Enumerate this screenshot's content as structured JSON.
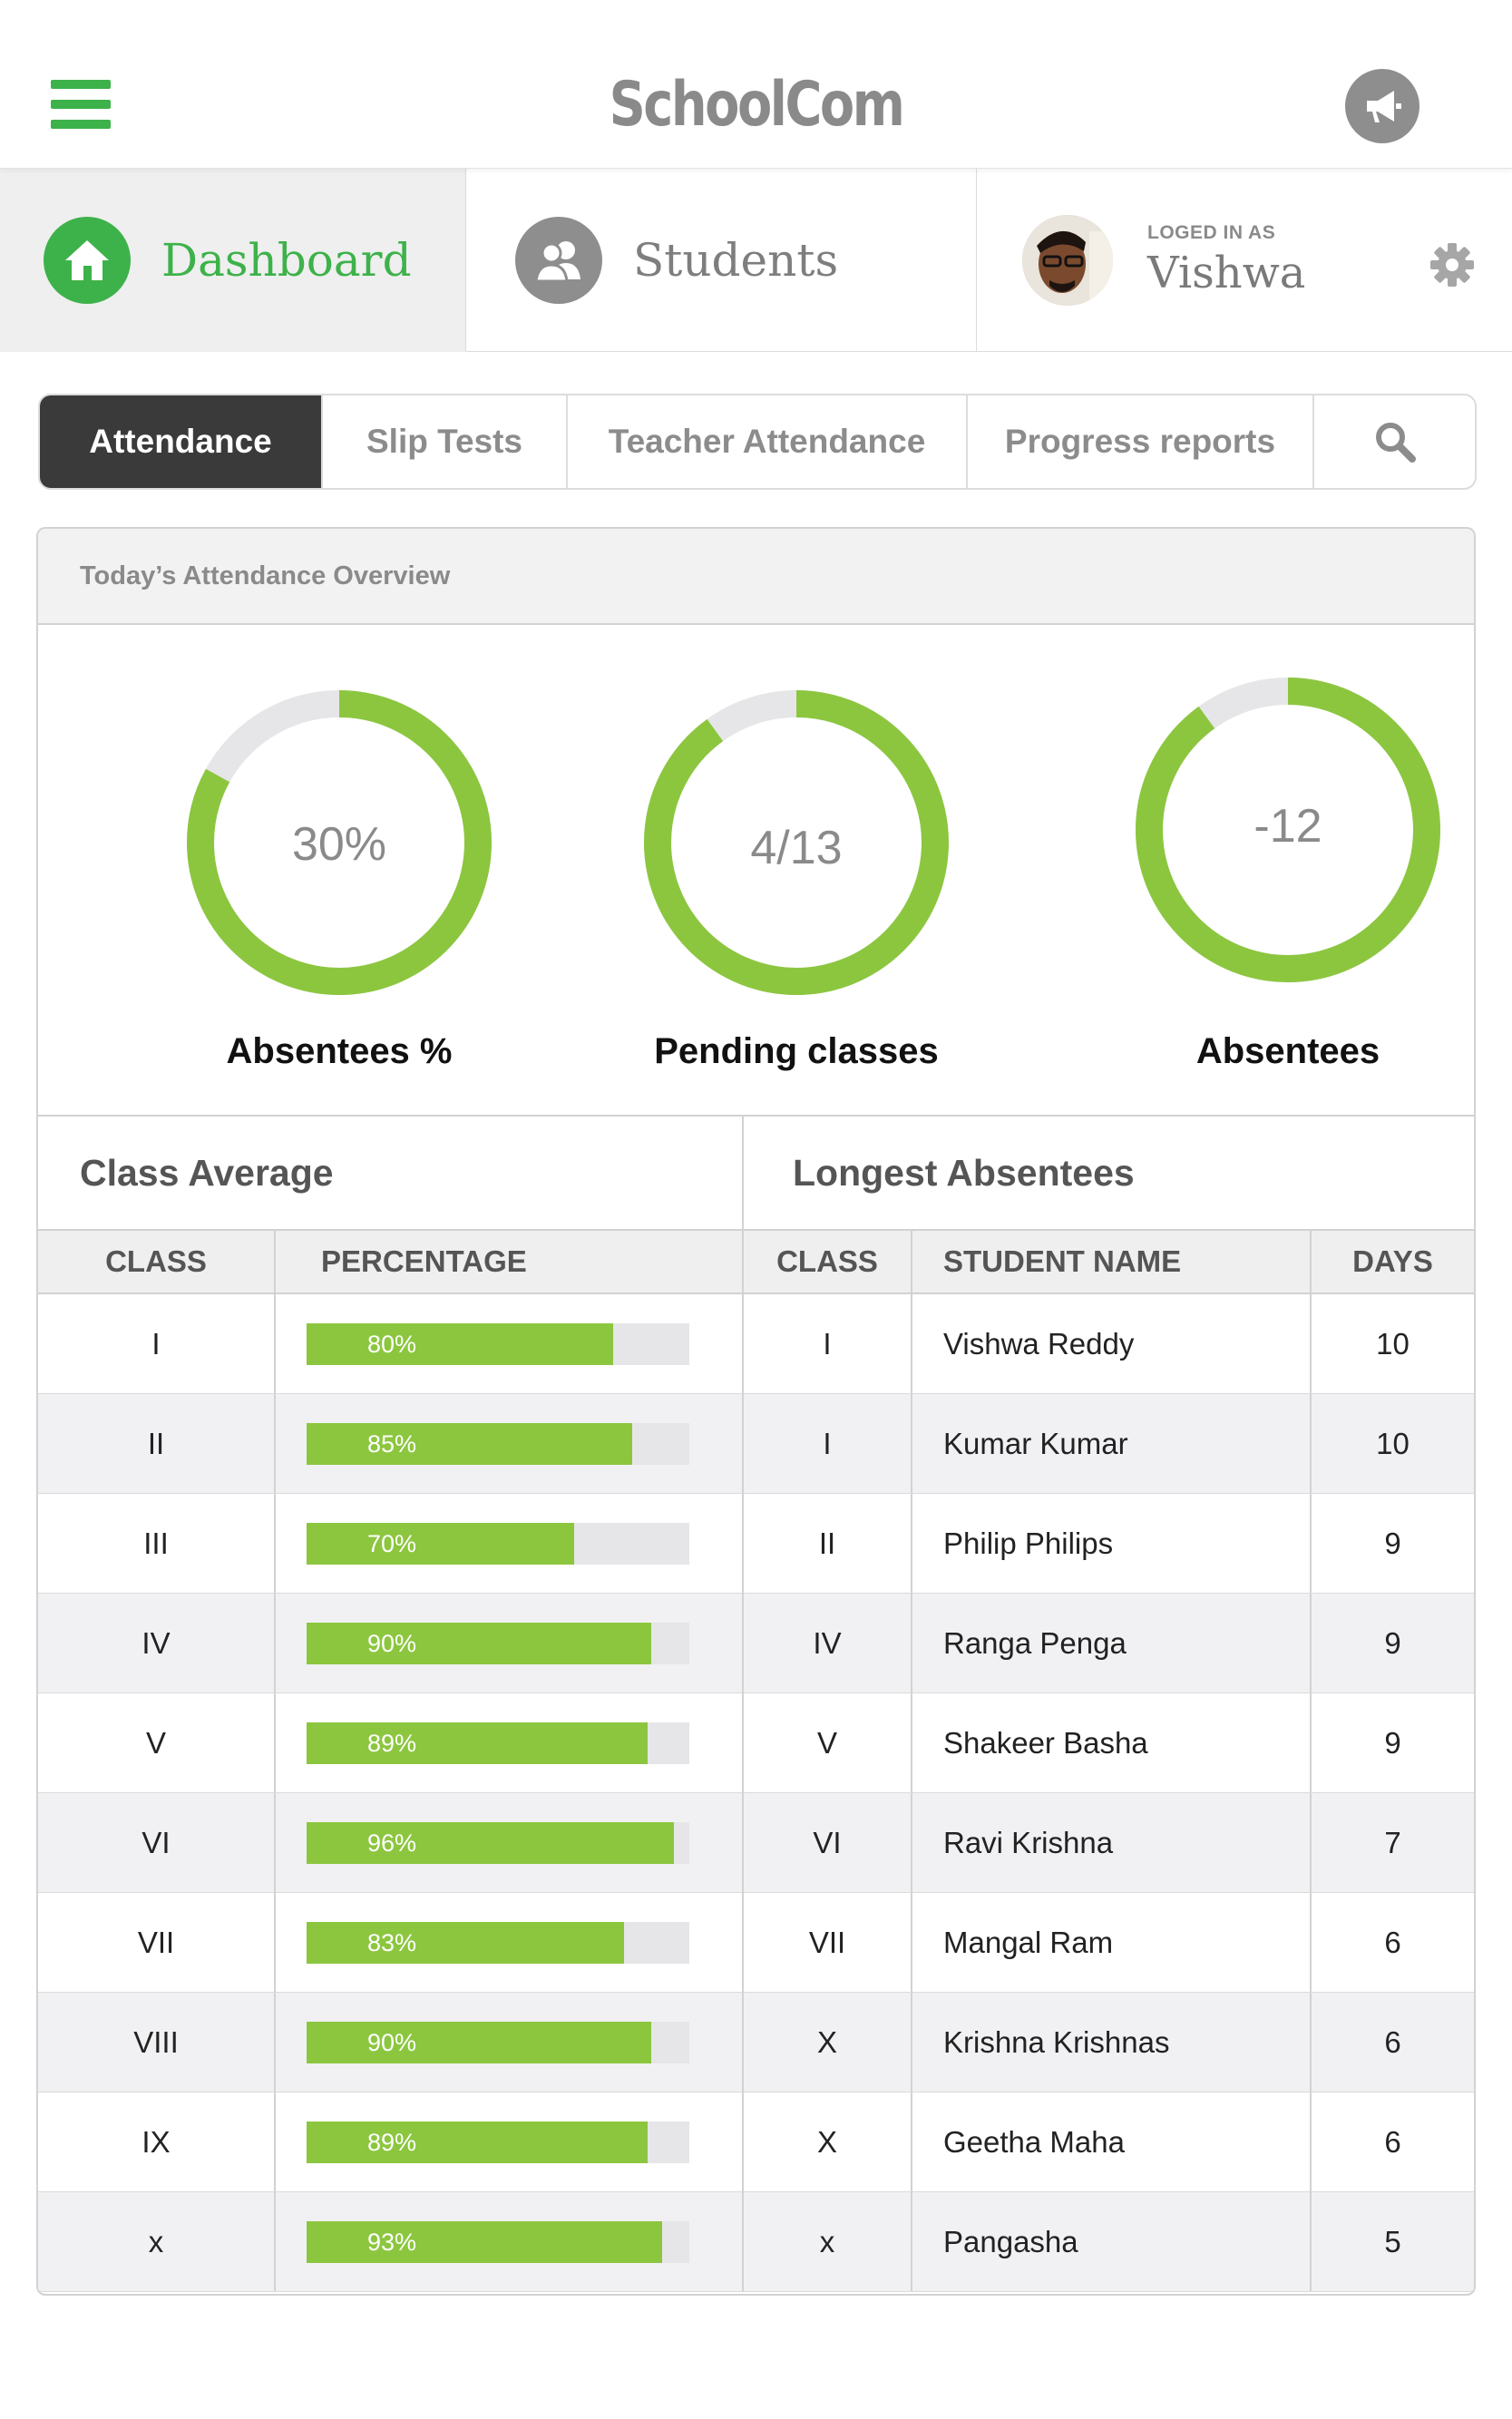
{
  "app": {
    "logo": "SchoolCom"
  },
  "nav": {
    "dashboard": "Dashboard",
    "students": "Students",
    "user": {
      "prefix": "LOGED IN AS",
      "name": "Vishwa"
    }
  },
  "tabs": [
    "Attendance",
    "Slip Tests",
    "Teacher Attendance",
    "Progress reports"
  ],
  "overview": {
    "title": "Today’s Attendance Overview",
    "gauges": [
      {
        "value": "30%",
        "label": "Absentees %",
        "fill": 0.83
      },
      {
        "value": "4/13",
        "label": "Pending classes",
        "fill": 0.9
      },
      {
        "value": "-12",
        "label": "Absentees",
        "fill": 0.9
      }
    ]
  },
  "class_average": {
    "title": "Class Average",
    "headers": [
      "CLASS",
      "PERCENTAGE"
    ],
    "rows": [
      {
        "class": "I",
        "pct": "80%",
        "value": 80
      },
      {
        "class": "II",
        "pct": "85%",
        "value": 85
      },
      {
        "class": "III",
        "pct": "70%",
        "value": 70
      },
      {
        "class": "IV",
        "pct": "90%",
        "value": 90
      },
      {
        "class": "V",
        "pct": "89%",
        "value": 89
      },
      {
        "class": "VI",
        "pct": "96%",
        "value": 96
      },
      {
        "class": "VII",
        "pct": "83%",
        "value": 83
      },
      {
        "class": "VIII",
        "pct": "90%",
        "value": 90
      },
      {
        "class": "IX",
        "pct": "89%",
        "value": 89
      },
      {
        "class": "x",
        "pct": "93%",
        "value": 93
      }
    ]
  },
  "longest_absentees": {
    "title": "Longest Absentees",
    "headers": [
      "CLASS",
      "STUDENT NAME",
      "DAYS"
    ],
    "rows": [
      {
        "class": "I",
        "name": "Vishwa Reddy",
        "days": "10"
      },
      {
        "class": "I",
        "name": "Kumar Kumar",
        "days": "10"
      },
      {
        "class": "II",
        "name": "Philip Philips",
        "days": "9"
      },
      {
        "class": "IV",
        "name": "Ranga Penga",
        "days": "9"
      },
      {
        "class": "V",
        "name": "Shakeer Basha",
        "days": "9"
      },
      {
        "class": "VI",
        "name": "Ravi Krishna",
        "days": "7"
      },
      {
        "class": "VII",
        "name": "Mangal Ram",
        "days": "6"
      },
      {
        "class": "X",
        "name": "Krishna Krishnas",
        "days": "6"
      },
      {
        "class": "X",
        "name": "Geetha Maha",
        "days": "6"
      },
      {
        "class": "x",
        "name": "Pangasha",
        "days": "5"
      }
    ]
  },
  "colors": {
    "brand": "#3db24a",
    "bar": "#8cc63f",
    "gauge": "#8cc63f",
    "track": "#e6e6e8"
  }
}
